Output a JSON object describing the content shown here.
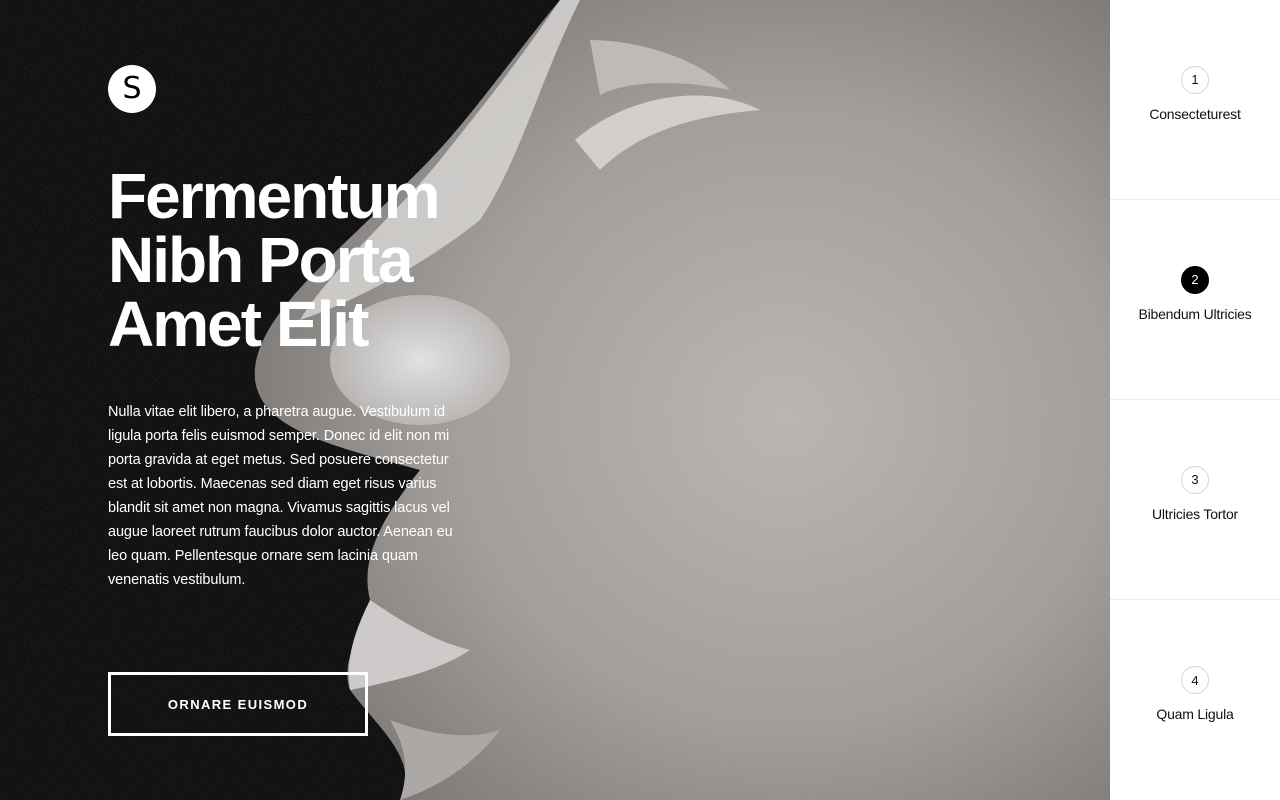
{
  "brand": {
    "logo_letter": "S"
  },
  "hero": {
    "headline_lines": [
      "Fermentum",
      "Nibh Porta",
      "Amet Elit"
    ],
    "body": "Nulla vitae elit libero, a pharetra augue. Vestibulum id ligula porta felis euismod semper. Donec id elit non mi porta gravida at eget metus. Sed posuere consectetur est at lobortis. Maecenas sed diam eget risus varius blandit sit amet non magna. Vivamus sagittis lacus vel augue laoreet rutrum faucibus dolor auctor. Aenean eu leo quam. Pellentesque ornare sem lacinia quam venenatis vestibulum.",
    "cta_label": "ORNARE EUISMOD"
  },
  "steps": [
    {
      "number": "1",
      "label": "Consecteturest",
      "active": false
    },
    {
      "number": "2",
      "label": "Bibendum Ultricies",
      "active": true
    },
    {
      "number": "3",
      "label": "Ultricies Tortor",
      "active": false
    },
    {
      "number": "4",
      "label": "Quam Ligula",
      "active": false
    }
  ],
  "colors": {
    "background": "#000000",
    "text_on_dark": "#ffffff",
    "sidebar_bg": "#ffffff",
    "active_step": "#000000"
  }
}
